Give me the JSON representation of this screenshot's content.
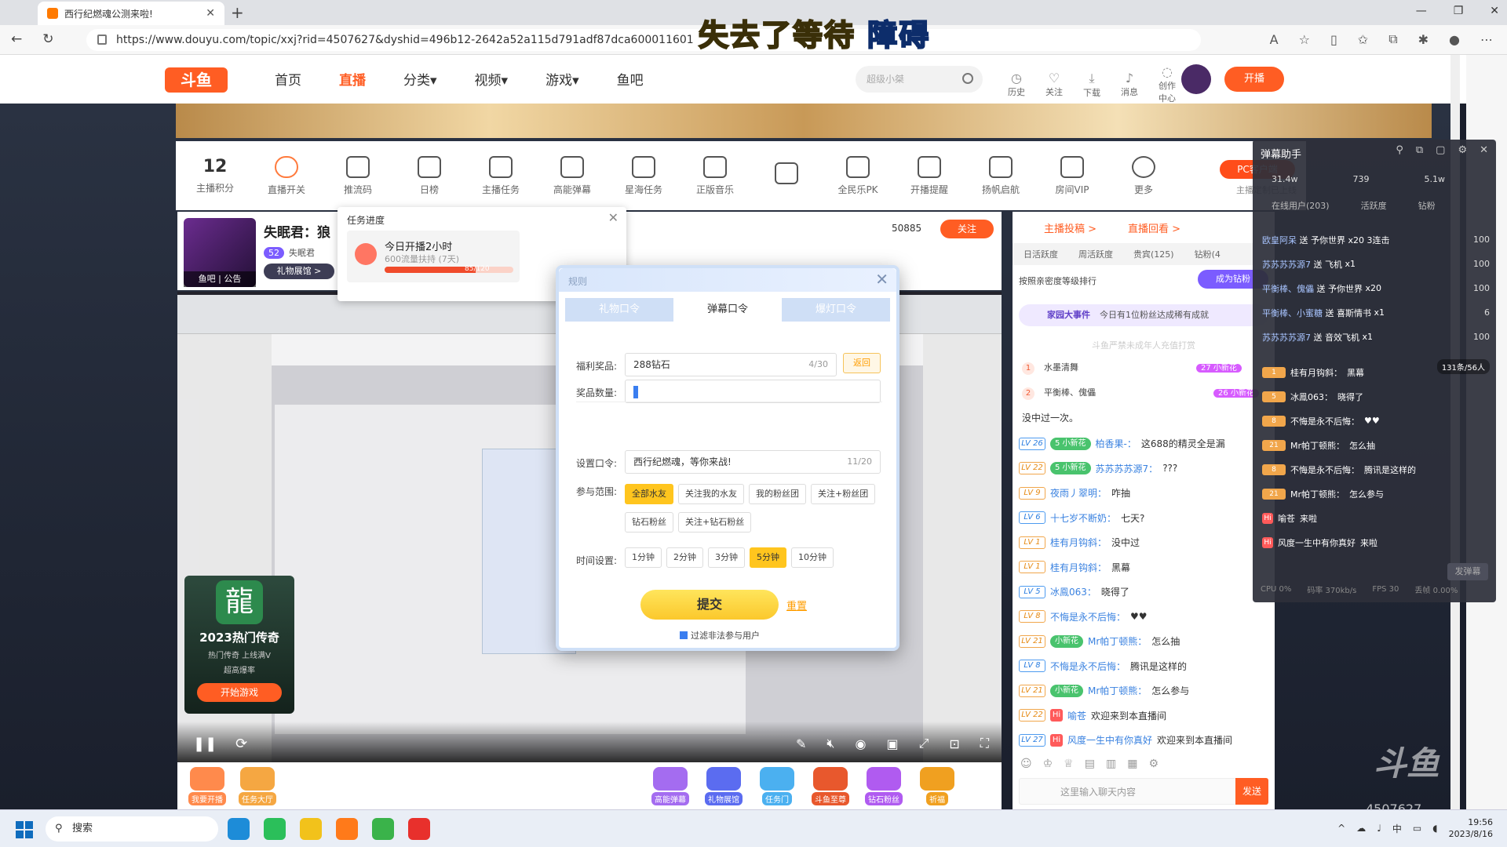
{
  "browser": {
    "tab_title": "西行纪燃魂公测来啦!",
    "new_tab": "+",
    "url": "https://www.douyu.com/topic/xxj?rid=4507627&dyshid=496b12-2642a52a115d791adf87dca600011601",
    "window_controls": [
      "—",
      "❐",
      "✕"
    ]
  },
  "banner": {
    "part1": "失去了等待",
    "part2": "障碍"
  },
  "site": {
    "logo": "斗鱼",
    "nav": [
      "首页",
      "直播",
      "分类▾",
      "视频▾",
      "游戏▾",
      "鱼吧"
    ],
    "search_placeholder": "超级小桀",
    "header_icons": [
      "历史",
      "关注",
      "下载",
      "消息",
      "创作中心"
    ],
    "open_button": "开播"
  },
  "toolbar": {
    "score_value": "12",
    "items": [
      "主播积分",
      "直播开关",
      "推流码",
      "日榜",
      "主播任务",
      "高能弹幕",
      "星海任务",
      "正版音乐",
      "",
      "全民乐PK",
      "开播提醒",
      "扬帆启航",
      "房间VIP",
      "更多"
    ],
    "pc_client": "PC客户端",
    "pc_sub": "主播定制已上线"
  },
  "room": {
    "avatar_caption": "鱼吧 | 公告",
    "name": "失眠君：狼",
    "level": "52",
    "level_name": "失眠君",
    "gift_button": "礼物展馆 >",
    "fans": "50885",
    "follow": "关注"
  },
  "task": {
    "header": "任务进度",
    "title": "今日开播2小时",
    "sub": "600流量扶持 (7天)",
    "progress": "85/120",
    "progress_pct": 70.8
  },
  "game": {
    "icon_char": "龍",
    "title": "2023热门传奇",
    "tags": "热门传奇  上线满V",
    "tag2": "超高爆率",
    "button": "开始游戏"
  },
  "bottom": [
    {
      "label": "我要开播",
      "color": "#ff8a4c"
    },
    {
      "label": "任务大厅",
      "color": "#f5a742"
    },
    {
      "label": "高能弹幕",
      "color": "#a46cf0"
    },
    {
      "label": "礼物展馆",
      "color": "#5b6cf0"
    },
    {
      "label": "任务门",
      "color": "#4bb0f0"
    },
    {
      "label": "斗鱼至尊",
      "color": "#e8582d"
    },
    {
      "label": "钻石粉丝",
      "color": "#b05bf0"
    },
    {
      "label": "祈福",
      "color": "#f0a020"
    }
  ],
  "right_panel": {
    "tabs": [
      "主播投稿 >",
      "直播回看 >"
    ],
    "subtabs": [
      "日活跃度",
      "周活跃度",
      "贵宾(125)",
      "钻粉(4"
    ],
    "rank_title": "按照亲密度等级排行",
    "rank_button": "成为钻粉",
    "event_title": "家园大事件",
    "event_text": "今日有1位粉丝达成稀有成就",
    "notice": "斗鱼严禁未成年人充值打赏",
    "ranks": [
      {
        "n": "1",
        "name": "水墨清舞",
        "badge": "27 小新花"
      },
      {
        "n": "2",
        "name": "平衡棒、傀儡",
        "badge": "26 小新花"
      }
    ],
    "chat_truncated": "没中过一次。",
    "chat": [
      {
        "lv": "LV 26",
        "badge": "5 小新花",
        "name": "柏香果-：",
        "text": "这688的精灵全是漏"
      },
      {
        "lv": "LV 22",
        "badge": "5 小新花",
        "name": "苏苏苏苏源7：",
        "text": "???"
      },
      {
        "lv": "LV 9",
        "badge": "",
        "name": "夜雨丿翠明：",
        "text": "咋抽"
      },
      {
        "lv": "LV 6",
        "badge": "",
        "name": "十七岁不断奶：",
        "text": "七天?"
      },
      {
        "lv": "LV 1",
        "badge": "",
        "name": "桂有月钩斜：",
        "text": "没中过"
      },
      {
        "lv": "LV 1",
        "badge": "",
        "name": "桂有月钩斜：",
        "text": "黑幕"
      },
      {
        "lv": "LV 5",
        "badge": "",
        "name": "冰鳯063：",
        "text": "晓得了"
      },
      {
        "lv": "LV 8",
        "badge": "",
        "name": "不悔是永不后悔：",
        "text": "♥♥"
      },
      {
        "lv": "LV 21",
        "badge": "小新花",
        "name": "Mr帕丁顿熊：",
        "text": "怎么抽"
      },
      {
        "lv": "LV 8",
        "badge": "",
        "name": "不悔是永不后悔：",
        "text": "腾讯是这样的"
      },
      {
        "lv": "LV 21",
        "badge": "小新花",
        "name": "Mr帕丁顿熊：",
        "text": "怎么参与"
      },
      {
        "lv": "LV 22",
        "hi": "Hi",
        "name": "喻苍",
        "text": "欢迎来到本直播间"
      },
      {
        "lv": "LV 27",
        "hi": "Hi",
        "name": "风度一生中有你真好",
        "text": "欢迎来到本直播间"
      }
    ],
    "chat_placeholder": "这里输入聊天内容",
    "send": "发送"
  },
  "dm_helper": {
    "title": "弹幕助手",
    "stats": [
      "31.4w",
      "739",
      "5.1w"
    ],
    "tabs": [
      "在线用户(203)",
      "活跃度",
      "钻粉"
    ],
    "gifts": [
      {
        "user": "欧皇阿呆",
        "gift": "送 予你世界",
        "count": "x20 3连击",
        "n": "100"
      },
      {
        "user": "苏苏苏苏源7",
        "gift": "送 飞机",
        "count": "x1",
        "n": "100"
      },
      {
        "user": "平衡棒、傀儡",
        "gift": "送 予你世界",
        "count": "x20",
        "n": "100"
      },
      {
        "user": "平衡棒、小蜜糖",
        "gift": "送 喜斯情书",
        "count": "x1",
        "n": "6"
      },
      {
        "user": "苏苏苏苏源7",
        "gift": "送 音效飞机",
        "count": "x1",
        "n": "100"
      }
    ],
    "online_badge": "131条/56人",
    "chat": [
      {
        "lv": "1",
        "name": "桂有月钩斜：",
        "text": "黑幕"
      },
      {
        "lv": "5",
        "name": "冰鳯063：",
        "text": "晓得了"
      },
      {
        "lv": "8",
        "name": "不悔是永不后悔：",
        "text": "♥♥"
      },
      {
        "lv": "21",
        "name": "Mr帕丁顿熊：",
        "text": "怎么抽"
      },
      {
        "lv": "8",
        "name": "不悔是永不后悔：",
        "text": "腾讯是这样的"
      },
      {
        "lv": "21",
        "name": "Mr帕丁顿熊：",
        "text": "怎么参与"
      },
      {
        "lv": "Hi",
        "name": "喻苍",
        "text": "来啦"
      },
      {
        "lv": "Hi",
        "name": "风度一生中有你真好",
        "text": "来啦"
      }
    ],
    "send_btn": "发弹幕",
    "footer": [
      "CPU 0%",
      "码率 370kb/s",
      "FPS 30",
      "丢帧 0.00%"
    ]
  },
  "modal": {
    "title": "规则",
    "tabs": [
      "礼物口令",
      "弹幕口令",
      "爆灯口令"
    ],
    "prize_label": "福利奖品:",
    "prize_value": "288钻石",
    "prize_count": "4/30",
    "back": "返回",
    "qty_label": "奖品数量:",
    "qty_value": "",
    "cmd_label": "设置口令:",
    "cmd_value": "西行纪燃魂，等你来战!",
    "cmd_count": "11/20",
    "range_label": "参与范围:",
    "range_opts": [
      "全部水友",
      "关注我的水友",
      "我的粉丝团",
      "关注+粉丝团",
      "钻石粉丝",
      "关注+钻石粉丝"
    ],
    "time_label": "时间设置:",
    "time_opts": [
      "1分钟",
      "2分钟",
      "3分钟",
      "5分钟",
      "10分钟"
    ],
    "submit": "提交",
    "reset": "重置",
    "filter": "过滤非法参与用户"
  },
  "taskbar": {
    "search": "搜索",
    "tray": [
      "^",
      "中"
    ],
    "time": "19:56",
    "date": "2023/8/16"
  },
  "watermark": "斗鱼",
  "room_id": "4507627",
  "colors": {
    "accent": "#ff5d23",
    "gold": "#ffc51e",
    "purple": "#7b5cff"
  }
}
